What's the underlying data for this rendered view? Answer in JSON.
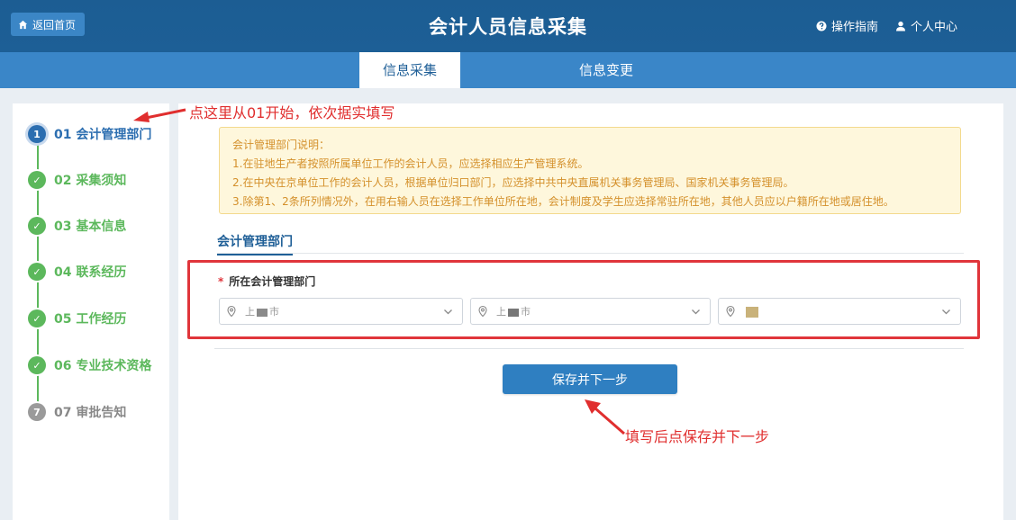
{
  "header": {
    "home_label": "返回首页",
    "title": "会计人员信息采集",
    "guide_label": "操作指南",
    "profile_label": "个人中心"
  },
  "tabs": [
    {
      "label": "信息采集",
      "active": true
    },
    {
      "label": "信息变更",
      "active": false
    }
  ],
  "steps": [
    {
      "num": "1",
      "label": "01 会计管理部门",
      "state": "current"
    },
    {
      "num": "✓",
      "label": "02 采集须知",
      "state": "done"
    },
    {
      "num": "✓",
      "label": "03 基本信息",
      "state": "done"
    },
    {
      "num": "✓",
      "label": "04 联系经历",
      "state": "done"
    },
    {
      "num": "✓",
      "label": "05 工作经历",
      "state": "done"
    },
    {
      "num": "✓",
      "label": "06 专业技术资格",
      "state": "done"
    },
    {
      "num": "7",
      "label": "07 审批告知",
      "state": "todo"
    }
  ],
  "annotations": {
    "step_hint": "点这里从01开始，依次据实填写",
    "save_hint": "填写后点保存并下一步"
  },
  "notice": {
    "title": "会计管理部门说明：",
    "lines": [
      "1.在驻地生产者按照所属单位工作的会计人员，应选择相应生产管理系统。",
      "2.在中央在京单位工作的会计人员，根据单位归口部门，应选择中共中央直属机关事务管理局、国家机关事务管理局。",
      "3.除第1、2条所列情况外，在用右输人员在选择工作单位所在地，会计制度及学生应选择常驻所在地，其他人员应以户籍所在地或居住地。"
    ]
  },
  "section": {
    "title": "会计管理部门"
  },
  "form": {
    "field_label": "所在会计管理部门",
    "required_mark": "*",
    "selects": [
      {
        "prefix": "上",
        "suffix": "市"
      },
      {
        "prefix": "上",
        "suffix": "市"
      },
      {
        "prefix": "",
        "suffix": ""
      }
    ]
  },
  "buttons": {
    "save_next": "保存并下一步"
  },
  "colors": {
    "header": "#1d5f96",
    "tabbar": "#3a86c8",
    "step_done": "#5cb85c",
    "step_current": "#2c6eb0",
    "step_todo": "#999999",
    "annotation": "#e02e2e",
    "primary": "#2f7fc1"
  },
  "icons": {
    "home": "home-icon",
    "guide": "help-circle-icon",
    "profile": "user-icon",
    "select_prefix": "location-pin-icon",
    "select_suffix": "chevron-down-icon"
  }
}
